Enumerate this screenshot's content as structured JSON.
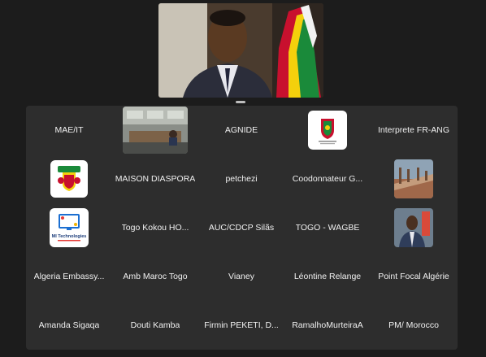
{
  "participants": [
    {
      "name": "MAE/IT"
    },
    {
      "name": ""
    },
    {
      "name": "AGNIDE"
    },
    {
      "name": ""
    },
    {
      "name": "Interprete FR-ANG"
    },
    {
      "name": ""
    },
    {
      "name": "MAISON DIASPORA"
    },
    {
      "name": "petchezi"
    },
    {
      "name": "Coodonnateur G..."
    },
    {
      "name": ""
    },
    {
      "name": ""
    },
    {
      "name": "Togo  Kokou HO..."
    },
    {
      "name": "AUC/CDCP Silãs"
    },
    {
      "name": "TOGO - WAGBE"
    },
    {
      "name": ""
    },
    {
      "name": "Algeria Embassy..."
    },
    {
      "name": "Amb Maroc Togo"
    },
    {
      "name": "Vianey"
    },
    {
      "name": "Léontine Relange"
    },
    {
      "name": "Point Focal Algérie"
    },
    {
      "name": "Amanda Sigaqa"
    },
    {
      "name": "Douti Kamba"
    },
    {
      "name": "Firmin  PEKETI, D..."
    },
    {
      "name": "RamalhoMurteiraA"
    },
    {
      "name": "PM/ Morocco"
    }
  ],
  "logos": {
    "mi_tech_text": "MI Technologies"
  },
  "colors": {
    "background": "#1c1c1c",
    "panel": "#2d2d2d",
    "text": "#f0f0f0"
  }
}
